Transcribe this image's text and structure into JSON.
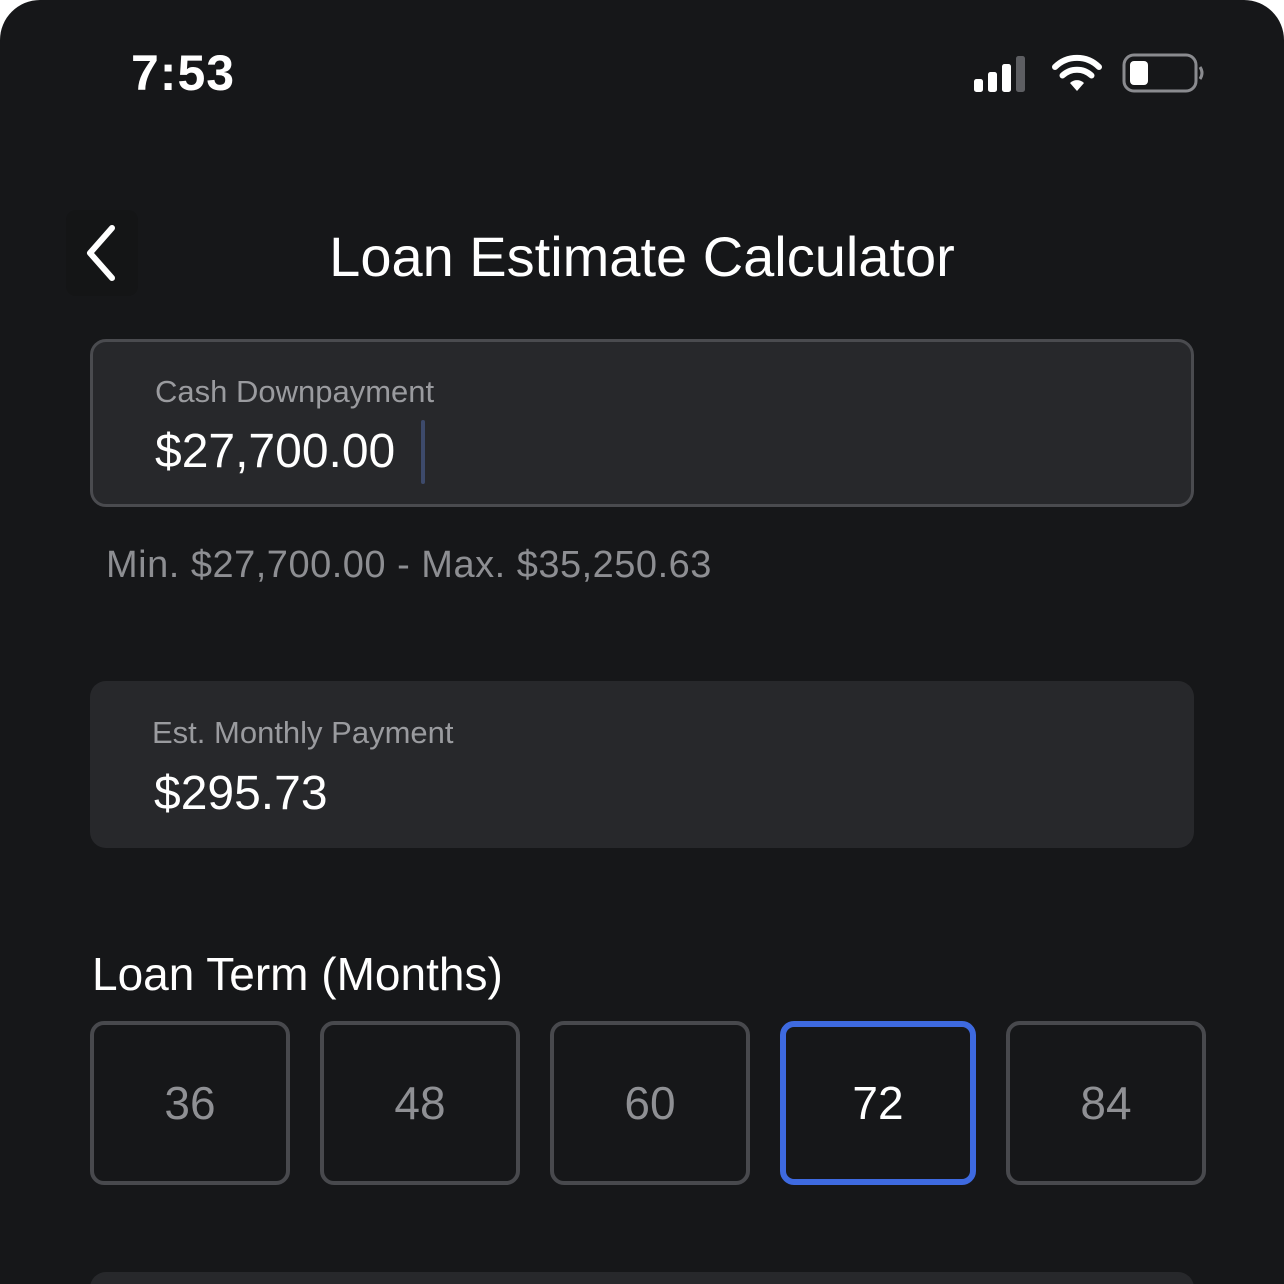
{
  "status_bar": {
    "time": "7:53",
    "icons": [
      "signal-icon",
      "wifi-icon",
      "battery-icon"
    ],
    "battery_level": 0.25
  },
  "header": {
    "back_icon": "chevron-left-icon",
    "title": "Loan Estimate Calculator"
  },
  "downpayment": {
    "label": "Cash Downpayment",
    "value": "$27,700.00",
    "range_hint": "Min. $27,700.00 - Max. $35,250.63"
  },
  "monthly_payment": {
    "label": "Est. Monthly Payment",
    "value": "$295.73"
  },
  "loan_term": {
    "title": "Loan Term (Months)",
    "options": [
      "36",
      "48",
      "60",
      "72",
      "84"
    ],
    "selected": "72"
  },
  "colors": {
    "background": "#161719",
    "card": "#27282b",
    "accent": "#3e6ae0",
    "muted_text": "#8d8e92"
  }
}
